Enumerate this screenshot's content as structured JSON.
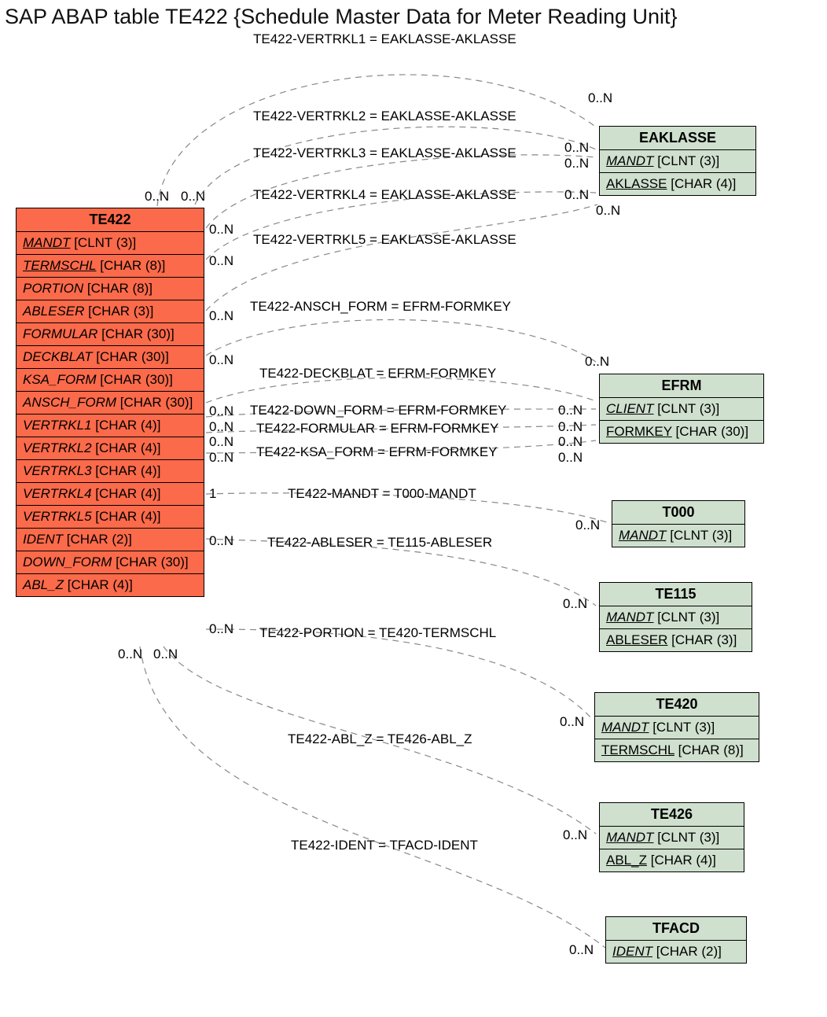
{
  "title": "SAP ABAP table TE422 {Schedule Master Data for Meter Reading Unit}",
  "entities": {
    "te422": {
      "name": "TE422",
      "fields": [
        {
          "n": "MANDT",
          "t": "[CLNT (3)]",
          "pk": true
        },
        {
          "n": "TERMSCHL",
          "t": "[CHAR (8)]",
          "pk": false,
          "u": true
        },
        {
          "n": "PORTION",
          "t": "[CHAR (8)]"
        },
        {
          "n": "ABLESER",
          "t": "[CHAR (3)]"
        },
        {
          "n": "FORMULAR",
          "t": "[CHAR (30)]"
        },
        {
          "n": "DECKBLAT",
          "t": "[CHAR (30)]"
        },
        {
          "n": "KSA_FORM",
          "t": "[CHAR (30)]"
        },
        {
          "n": "ANSCH_FORM",
          "t": "[CHAR (30)]"
        },
        {
          "n": "VERTRKL1",
          "t": "[CHAR (4)]"
        },
        {
          "n": "VERTRKL2",
          "t": "[CHAR (4)]"
        },
        {
          "n": "VERTRKL3",
          "t": "[CHAR (4)]"
        },
        {
          "n": "VERTRKL4",
          "t": "[CHAR (4)]"
        },
        {
          "n": "VERTRKL5",
          "t": "[CHAR (4)]"
        },
        {
          "n": "IDENT",
          "t": "[CHAR (2)]"
        },
        {
          "n": "DOWN_FORM",
          "t": "[CHAR (30)]"
        },
        {
          "n": "ABL_Z",
          "t": "[CHAR (4)]"
        }
      ]
    },
    "eaklasse": {
      "name": "EAKLASSE",
      "fields": [
        {
          "n": "MANDT",
          "t": "[CLNT (3)]",
          "pk": true
        },
        {
          "n": "AKLASSE",
          "t": "[CHAR (4)]",
          "u": true
        }
      ]
    },
    "efrm": {
      "name": "EFRM",
      "fields": [
        {
          "n": "CLIENT",
          "t": "[CLNT (3)]",
          "pk": true
        },
        {
          "n": "FORMKEY",
          "t": "[CHAR (30)]",
          "u": true
        }
      ]
    },
    "t000": {
      "name": "T000",
      "fields": [
        {
          "n": "MANDT",
          "t": "[CLNT (3)]",
          "pk": true
        }
      ]
    },
    "te115": {
      "name": "TE115",
      "fields": [
        {
          "n": "MANDT",
          "t": "[CLNT (3)]",
          "pk": true
        },
        {
          "n": "ABLESER",
          "t": "[CHAR (3)]",
          "u": true
        }
      ]
    },
    "te420": {
      "name": "TE420",
      "fields": [
        {
          "n": "MANDT",
          "t": "[CLNT (3)]",
          "pk": true
        },
        {
          "n": "TERMSCHL",
          "t": "[CHAR (8)]",
          "u": true
        }
      ]
    },
    "te426": {
      "name": "TE426",
      "fields": [
        {
          "n": "MANDT",
          "t": "[CLNT (3)]",
          "pk": true
        },
        {
          "n": "ABL_Z",
          "t": "[CHAR (4)]",
          "u": true
        }
      ]
    },
    "tfacd": {
      "name": "TFACD",
      "fields": [
        {
          "n": "IDENT",
          "t": "[CHAR (2)]",
          "pk": true
        }
      ]
    }
  },
  "relations": [
    {
      "id": "r1",
      "label": "TE422-VERTRKL1 = EAKLASSE-AKLASSE"
    },
    {
      "id": "r2",
      "label": "TE422-VERTRKL2 = EAKLASSE-AKLASSE"
    },
    {
      "id": "r3",
      "label": "TE422-VERTRKL3 = EAKLASSE-AKLASSE"
    },
    {
      "id": "r4",
      "label": "TE422-VERTRKL4 = EAKLASSE-AKLASSE"
    },
    {
      "id": "r5",
      "label": "TE422-VERTRKL5 = EAKLASSE-AKLASSE"
    },
    {
      "id": "r6",
      "label": "TE422-ANSCH_FORM = EFRM-FORMKEY"
    },
    {
      "id": "r7",
      "label": "TE422-DECKBLAT = EFRM-FORMKEY"
    },
    {
      "id": "r8",
      "label": "TE422-DOWN_FORM = EFRM-FORMKEY"
    },
    {
      "id": "r9",
      "label": "TE422-FORMULAR = EFRM-FORMKEY"
    },
    {
      "id": "r10",
      "label": "TE422-KSA_FORM = EFRM-FORMKEY"
    },
    {
      "id": "r11",
      "label": "TE422-MANDT = T000-MANDT"
    },
    {
      "id": "r12",
      "label": "TE422-ABLESER = TE115-ABLESER"
    },
    {
      "id": "r13",
      "label": "TE422-PORTION = TE420-TERMSCHL"
    },
    {
      "id": "r14",
      "label": "TE422-ABL_Z = TE426-ABL_Z"
    },
    {
      "id": "r15",
      "label": "TE422-IDENT = TFACD-IDENT"
    }
  ],
  "cards": {
    "c1": "0..N",
    "c2": "0..N",
    "c3": "0..N",
    "c4": "0..N",
    "c5": "0..N",
    "c6": "0..N",
    "c7": "0..N",
    "c8": "0..N",
    "c9": "0..N",
    "c10": "0..N",
    "c11": "0..N",
    "c12": "0..N",
    "c13": "0..N",
    "c14": "0..N",
    "c15": "0..N",
    "c16": "1",
    "c17": "0..N",
    "c18": "0..N",
    "c19": "0..N",
    "c20": "0..N",
    "c21": "0..N",
    "c22": "0..N",
    "c23": "0..N",
    "c24": "0..N",
    "c25": "0..N",
    "c26": "0..N",
    "c27": "0..N",
    "c28": "0..N",
    "c29": "0..N",
    "c30": "0..N"
  }
}
